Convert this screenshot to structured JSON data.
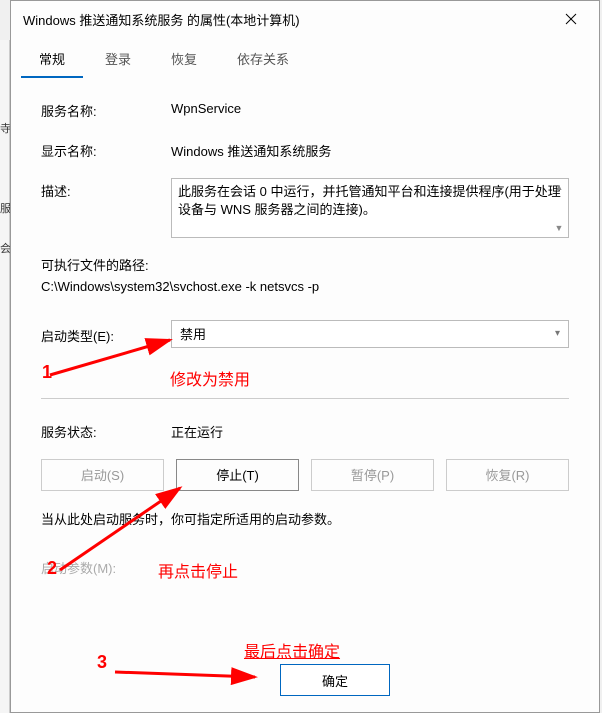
{
  "window": {
    "title": "Windows 推送通知系统服务 的属性(本地计算机)"
  },
  "tabs": {
    "general": "常规",
    "logon": "登录",
    "recovery": "恢复",
    "dependencies": "依存关系"
  },
  "fields": {
    "service_name_label": "服务名称:",
    "service_name_value": "WpnService",
    "display_name_label": "显示名称:",
    "display_name_value": "Windows 推送通知系统服务",
    "description_label": "描述:",
    "description_value": "此服务在会话 0 中运行，并托管通知平台和连接提供程序(用于处理设备与 WNS 服务器之间的连接)。",
    "exe_path_label": "可执行文件的路径:",
    "exe_path_value": "C:\\Windows\\system32\\svchost.exe -k netsvcs -p",
    "startup_type_label": "启动类型(E):",
    "startup_type_value": "禁用",
    "service_status_label": "服务状态:",
    "service_status_value": "正在运行",
    "start_params_note": "当从此处启动服务时，你可指定所适用的启动参数。",
    "start_params_label": "启动参数(M):"
  },
  "buttons": {
    "start": "启动(S)",
    "stop": "停止(T)",
    "pause": "暂停(P)",
    "resume": "恢复(R)",
    "ok": "确定"
  },
  "annotations": {
    "num1": "1",
    "text1": "修改为禁用",
    "num2": "2",
    "text2": "再点击停止",
    "num3": "3",
    "text3": "最后点击确定"
  },
  "left_edge": {
    "t1": "寺",
    "t2": "服",
    "t3": "会"
  }
}
